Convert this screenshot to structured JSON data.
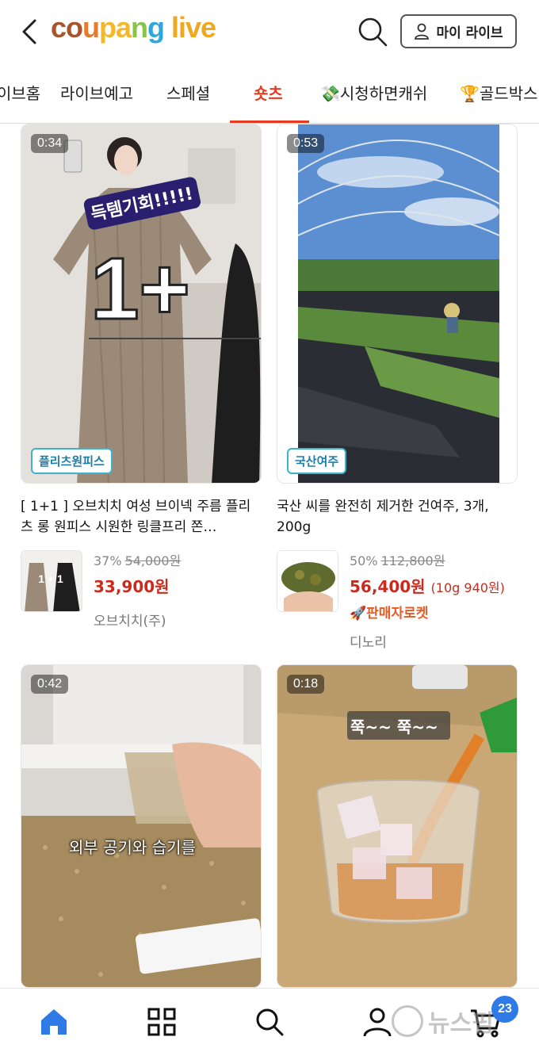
{
  "header": {
    "logo_parts": [
      "co",
      "u",
      "pa",
      "n",
      "g",
      " live"
    ],
    "mylive_label": "마이 라이브"
  },
  "tabs": [
    {
      "label": "이브홈"
    },
    {
      "label": "라이브예고"
    },
    {
      "label": "스페셜"
    },
    {
      "label": "숏츠",
      "active": true
    },
    {
      "label": "💸시청하면캐쉬"
    },
    {
      "label": "🏆골드박스"
    }
  ],
  "cards": [
    {
      "duration": "0:34",
      "tag": "플리츠원피스",
      "title": "[ 1+1 ] 오브치치 여성 브이넥 주름 플리츠 롱 원피스 시원한 링클프리 쫀…",
      "discount": "37%",
      "original_price": "54,000원",
      "price": "33,900원",
      "seller": "오브치치(주)",
      "overlay_text": "득템기회!!!!!",
      "overlay_big": "1+"
    },
    {
      "duration": "0:53",
      "tag": "국산여주",
      "title": "국산 씨를 완전히 제거한 건여주, 3개, 200g",
      "discount": "50%",
      "original_price": "112,800원",
      "price": "56,400원",
      "unit_price": "(10g 940원)",
      "rocket": "🚀판매자로켓",
      "seller": "디노리"
    },
    {
      "duration": "0:42",
      "caption": "외부 공기와 습기를"
    },
    {
      "duration": "0:18",
      "caption": "쭉~~ 쭉~~"
    }
  ],
  "bottom_nav": {
    "cart_badge": "23",
    "watermark": "뉴스핌"
  },
  "colors": {
    "accent": "#e53b1f",
    "price": "#c92b1e",
    "tag_border": "#3fb2cf",
    "badge": "#2e7be8"
  }
}
